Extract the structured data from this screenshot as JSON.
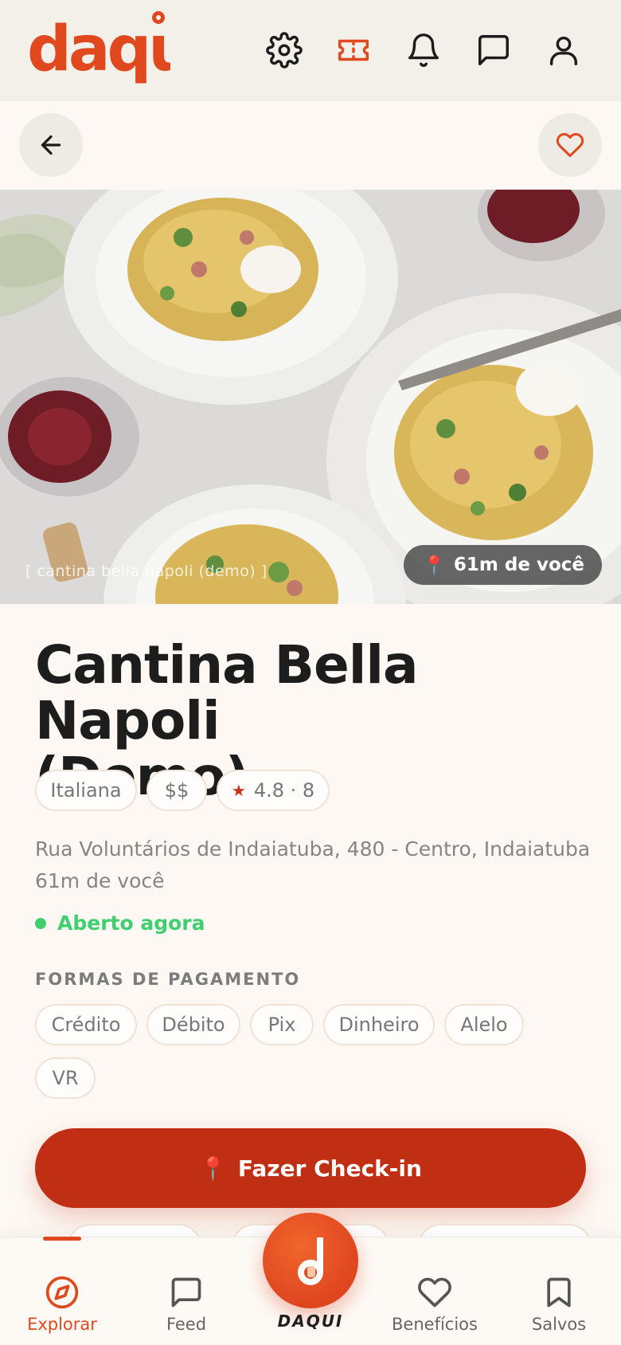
{
  "header": {
    "logo_text": "daqui",
    "icons": [
      "gear-icon",
      "ticket-icon",
      "bell-icon",
      "chat-icon",
      "user-icon"
    ]
  },
  "subbar": {
    "back_icon": "arrow-left-icon",
    "favorite_icon": "heart-icon"
  },
  "hero": {
    "caption": "[ cantina bella napoli (demo) ]",
    "distance_pin": "📍",
    "distance_label": "61m de você"
  },
  "place": {
    "title_line1": "Cantina Bella Napoli",
    "title_line2": "(Demo)",
    "cuisine": "Italiana",
    "price": "$$",
    "rating_star": "★",
    "rating": "4.8 · 8",
    "address": "Rua Voluntários de Indaiatuba, 480 - Centro, Indaiatuba",
    "distance": "61m de você",
    "status": "Aberto agora"
  },
  "payments": {
    "label": "FORMAS DE PAGAMENTO",
    "methods": [
      "Crédito",
      "Débito",
      "Pix",
      "Dinheiro",
      "Alelo",
      "VR"
    ]
  },
  "checkin": {
    "pin": "📍",
    "label": "Fazer Check-in"
  },
  "nav": {
    "items": [
      {
        "label": "Explorar",
        "icon": "compass-icon",
        "active": true
      },
      {
        "label": "Feed",
        "icon": "chat-icon"
      },
      {
        "label": "Benefícios",
        "icon": "heart-icon"
      },
      {
        "label": "Salvos",
        "icon": "bookmark-icon"
      }
    ],
    "center_label": "DAQUI"
  },
  "colors": {
    "brand": "#e0491e",
    "brand_dark": "#c02e14",
    "open_status": "#3fcf70",
    "background": "#fdf8f3"
  }
}
